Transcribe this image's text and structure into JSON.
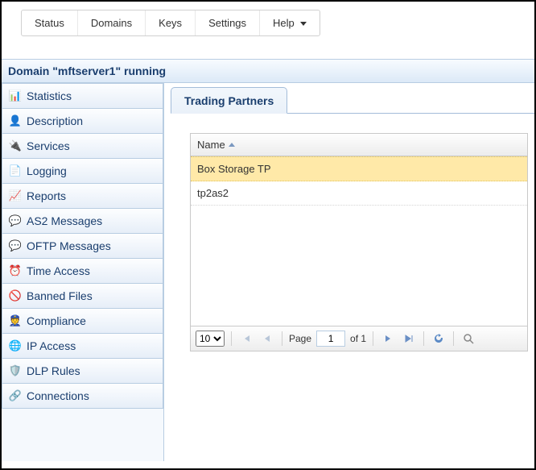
{
  "topnav": {
    "status": "Status",
    "domains": "Domains",
    "keys": "Keys",
    "settings": "Settings",
    "help": "Help"
  },
  "status_bar": "Domain \"mftserver1\" running",
  "sidebar": {
    "items": [
      {
        "label": "Statistics",
        "icon": "📊"
      },
      {
        "label": "Description",
        "icon": "👤"
      },
      {
        "label": "Services",
        "icon": "🔌"
      },
      {
        "label": "Logging",
        "icon": "📄"
      },
      {
        "label": "Reports",
        "icon": "📈"
      },
      {
        "label": "AS2 Messages",
        "icon": "💬"
      },
      {
        "label": "OFTP Messages",
        "icon": "💬"
      },
      {
        "label": "Time Access",
        "icon": "⏰"
      },
      {
        "label": "Banned Files",
        "icon": "🚫"
      },
      {
        "label": "Compliance",
        "icon": "👮"
      },
      {
        "label": "IP Access",
        "icon": "🌐"
      },
      {
        "label": "DLP Rules",
        "icon": "🛡️"
      },
      {
        "label": "Connections",
        "icon": "🔗"
      }
    ]
  },
  "tabs": {
    "trading_partners": "Trading Partners"
  },
  "grid": {
    "header_name": "Name",
    "rows": [
      {
        "name": "Box Storage TP",
        "selected": true
      },
      {
        "name": "tp2as2",
        "selected": false
      }
    ]
  },
  "pager": {
    "page_size": "10",
    "page_label": "Page",
    "current_page": "1",
    "total_pages_label": "of 1"
  }
}
